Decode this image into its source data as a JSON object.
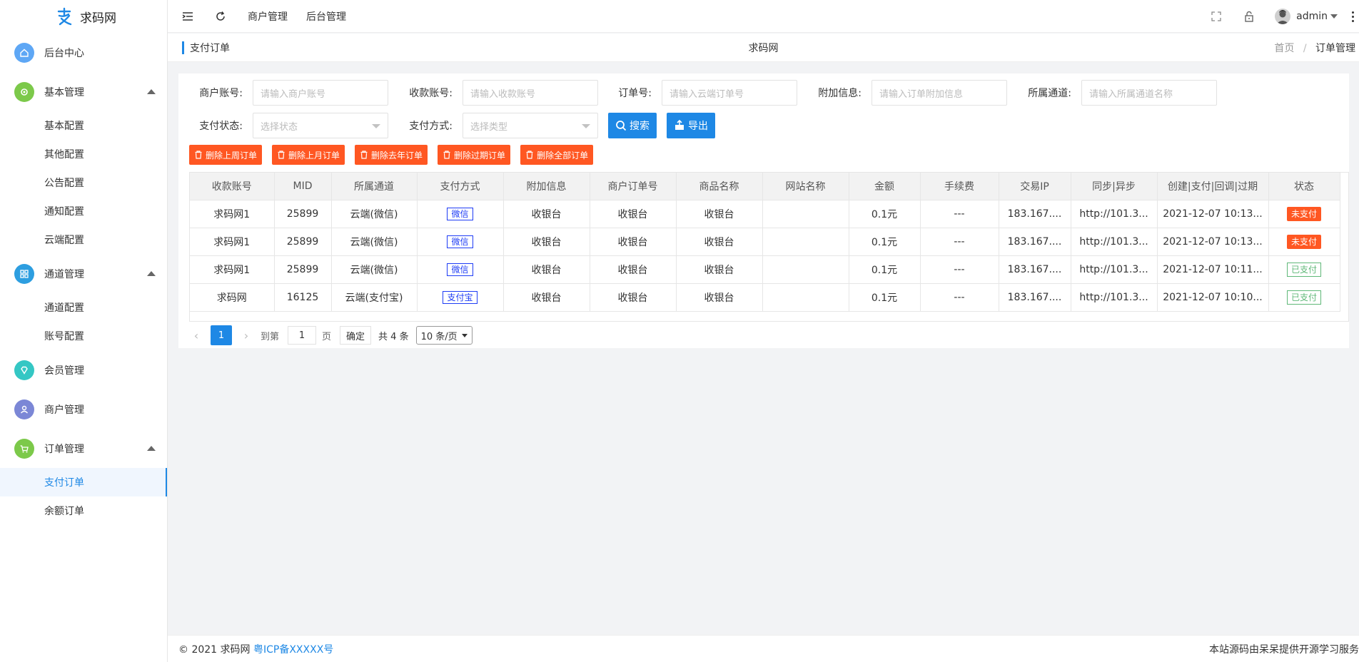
{
  "app": {
    "name": "求码网"
  },
  "sidebar": {
    "items": [
      {
        "label": "后台中心",
        "icon": "home-icon",
        "color": "#5ea7f5"
      },
      {
        "label": "基本管理",
        "icon": "gear-icon",
        "color": "#7cc94a",
        "children": [
          "基本配置",
          "其他配置",
          "公告配置",
          "通知配置",
          "云端配置"
        ]
      },
      {
        "label": "通道管理",
        "icon": "channel-icon",
        "color": "#2d9ee0",
        "children": [
          "通道配置",
          "账号配置"
        ]
      },
      {
        "label": "会员管理",
        "icon": "diamond-icon",
        "color": "#34c7c4"
      },
      {
        "label": "商户管理",
        "icon": "user-icon",
        "color": "#7b87d6"
      },
      {
        "label": "订单管理",
        "icon": "cart-icon",
        "color": "#7cc94a",
        "children": [
          "支付订单",
          "余额订单"
        ]
      }
    ],
    "active": "支付订单"
  },
  "topbar": {
    "nav": [
      "商户管理",
      "后台管理"
    ],
    "user": "admin"
  },
  "subhead": {
    "title": "支付订单",
    "center": "求码网",
    "crumb_home": "首页",
    "crumb_sep": "/",
    "crumb_current": "订单管理"
  },
  "filters": {
    "merchant_label": "商户账号:",
    "merchant_placeholder": "请输入商户账号",
    "receive_label": "收款账号:",
    "receive_placeholder": "请输入收款账号",
    "order_label": "订单号:",
    "order_placeholder": "请输入云端订单号",
    "extra_label": "附加信息:",
    "extra_placeholder": "请输入订单附加信息",
    "channel_label": "所属通道:",
    "channel_placeholder": "请输入所属通道名称",
    "status_label": "支付状态:",
    "status_placeholder": "选择状态",
    "method_label": "支付方式:",
    "method_placeholder": "选择类型",
    "search_label": "搜索",
    "export_label": "导出"
  },
  "delete_buttons": [
    "删除上周订单",
    "删除上月订单",
    "删除去年订单",
    "删除过期订单",
    "删除全部订单"
  ],
  "table": {
    "columns": [
      "收款账号",
      "MID",
      "所属通道",
      "支付方式",
      "附加信息",
      "商户订单号",
      "商品名称",
      "网站名称",
      "金额",
      "手续费",
      "交易IP",
      "同步|异步",
      "创建|支付|回调|过期",
      "状态"
    ],
    "rows": [
      {
        "account": "求码网1",
        "mid": "25899",
        "channel": "云端(微信)",
        "method": "微信",
        "extra": "收银台",
        "order_no": "收银台",
        "goods": "收银台",
        "site": "",
        "amount": "0.1元",
        "fee": "---",
        "ip": "183.167....",
        "notify": "http://101.3...",
        "time": "2021-12-07 10:13...",
        "status": "未支付",
        "status_type": "unpaid"
      },
      {
        "account": "求码网1",
        "mid": "25899",
        "channel": "云端(微信)",
        "method": "微信",
        "extra": "收银台",
        "order_no": "收银台",
        "goods": "收银台",
        "site": "",
        "amount": "0.1元",
        "fee": "---",
        "ip": "183.167....",
        "notify": "http://101.3...",
        "time": "2021-12-07 10:13...",
        "status": "未支付",
        "status_type": "unpaid"
      },
      {
        "account": "求码网1",
        "mid": "25899",
        "channel": "云端(微信)",
        "method": "微信",
        "extra": "收银台",
        "order_no": "收银台",
        "goods": "收银台",
        "site": "",
        "amount": "0.1元",
        "fee": "---",
        "ip": "183.167....",
        "notify": "http://101.3...",
        "time": "2021-12-07 10:11...",
        "status": "已支付",
        "status_type": "paid"
      },
      {
        "account": "求码网",
        "mid": "16125",
        "channel": "云端(支付宝)",
        "method": "支付宝",
        "extra": "收银台",
        "order_no": "收银台",
        "goods": "收银台",
        "site": "",
        "amount": "0.1元",
        "fee": "---",
        "ip": "183.167....",
        "notify": "http://101.3...",
        "time": "2021-12-07 10:10...",
        "status": "已支付",
        "status_type": "paid"
      }
    ]
  },
  "pager": {
    "current": "1",
    "goto_label": "到第",
    "goto_value": "1",
    "page_unit": "页",
    "confirm": "确定",
    "total": "共 4 条",
    "page_size": "10 条/页"
  },
  "footer": {
    "copyright": "© 2021 求码网",
    "icp": "粤ICP备XXXXX号",
    "right": "本站源码由呆呆提供开源学习服务"
  }
}
